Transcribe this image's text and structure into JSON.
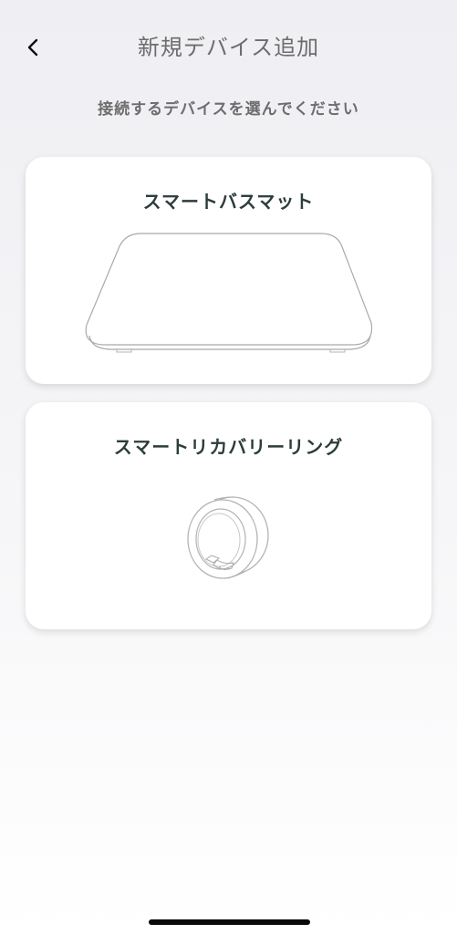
{
  "header": {
    "back_icon": "chevron-left-icon",
    "title": "新規デバイス追加"
  },
  "subtitle": "接続するデバイスを選んでください",
  "devices": [
    {
      "name": "スマートバスマット",
      "icon": "bathmat-illustration"
    },
    {
      "name": "スマートリカバリーリング",
      "icon": "ring-illustration"
    }
  ],
  "colors": {
    "card_background": "#ffffff",
    "title_text": "#6c6c6c",
    "card_title_text": "#2d3c3c"
  }
}
